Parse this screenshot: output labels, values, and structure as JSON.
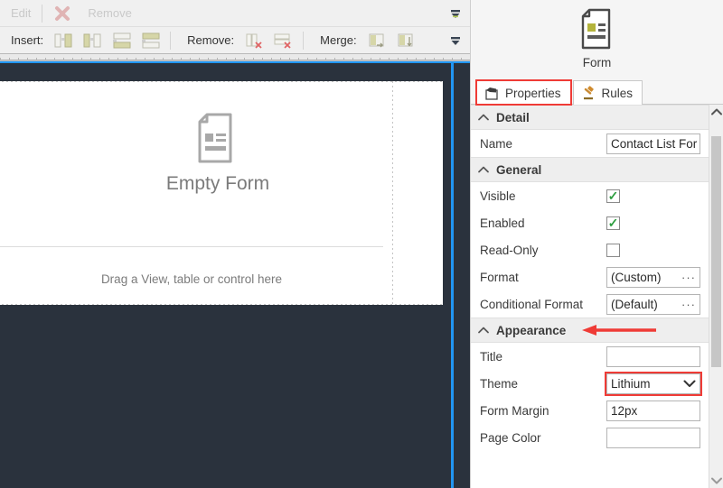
{
  "toolbar": {
    "row1": {
      "edit_label": "Edit",
      "remove_label": "Remove",
      "overflow_icon": "chevron-down-icon"
    },
    "row2": {
      "insert_label": "Insert:",
      "remove_label": "Remove:",
      "merge_label": "Merge:",
      "overflow_icon": "chevron-down-icon",
      "insert_buttons": [
        "insert-column-left-icon",
        "insert-column-right-icon",
        "insert-row-above-icon",
        "insert-row-below-icon"
      ],
      "remove_buttons": [
        "remove-column-icon",
        "remove-row-icon"
      ],
      "merge_buttons": [
        "merge-right-icon",
        "merge-down-icon"
      ]
    }
  },
  "canvas": {
    "empty_form_title": "Empty Form",
    "drop_hint": "Drag a View, table or control here",
    "doc_icon": "document-icon",
    "background_color": "#2a323d",
    "selection_border_color": "#2196f3"
  },
  "panel": {
    "header": {
      "title": "Form",
      "icon": "form-document-icon"
    },
    "tabs": [
      {
        "label": "Properties",
        "icon": "properties-icon",
        "selected": true
      },
      {
        "label": "Rules",
        "icon": "gavel-icon",
        "selected": false
      }
    ],
    "highlight_color": "#ef3b36",
    "groups": [
      {
        "name": "Detail",
        "collapse_icon": "chevron-up-icon",
        "rows": [
          {
            "label": "Name",
            "type": "text",
            "value": "Contact List For",
            "highlight": false
          }
        ]
      },
      {
        "name": "General",
        "collapse_icon": "chevron-up-icon",
        "rows": [
          {
            "label": "Visible",
            "type": "checkbox",
            "value": "checked",
            "highlight": false
          },
          {
            "label": "Enabled",
            "type": "checkbox",
            "value": "checked",
            "highlight": false
          },
          {
            "label": "Read-Only",
            "type": "checkbox",
            "value": "unchecked",
            "highlight": false
          },
          {
            "label": "Format",
            "type": "text-ellipsis",
            "value": "(Custom)",
            "ellipsis": "···",
            "highlight": false
          },
          {
            "label": "Conditional Format",
            "type": "text-ellipsis",
            "value": "(Default)",
            "ellipsis": "···",
            "highlight": false
          }
        ]
      },
      {
        "name": "Appearance",
        "collapse_icon": "chevron-up-icon",
        "annotated": true,
        "rows": [
          {
            "label": "Title",
            "type": "text",
            "value": "",
            "highlight": false
          },
          {
            "label": "Theme",
            "type": "combo",
            "value": "Lithium",
            "highlight": true
          },
          {
            "label": "Form Margin",
            "type": "text",
            "value": "12px",
            "highlight": false
          },
          {
            "label": "Page Color",
            "type": "text",
            "value": "",
            "highlight": false
          }
        ]
      }
    ],
    "scrollbar": {
      "up_arrow_icon": "chevron-up-icon",
      "down_arrow_icon": "chevron-down-icon"
    }
  }
}
